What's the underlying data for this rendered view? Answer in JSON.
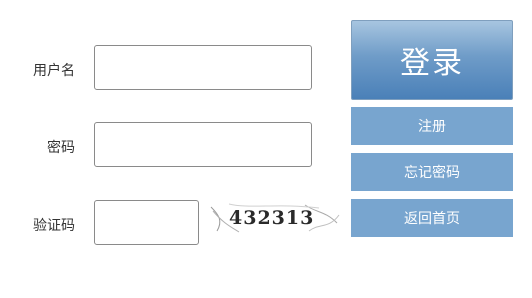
{
  "form": {
    "username_label": "用户名",
    "username_value": "",
    "password_label": "密码",
    "password_value": "",
    "captcha_label": "验证码",
    "captcha_value": "",
    "captcha_image_text": "432313"
  },
  "buttons": {
    "login": "登录",
    "register": "注册",
    "forgot_password": "忘记密码",
    "back_home": "返回首页"
  },
  "colors": {
    "login_button_gradient_top": "#a7c5e0",
    "login_button_gradient_bottom": "#4a80b8",
    "secondary_button": "#78a5cf",
    "field_border": "#8a8a8a"
  }
}
